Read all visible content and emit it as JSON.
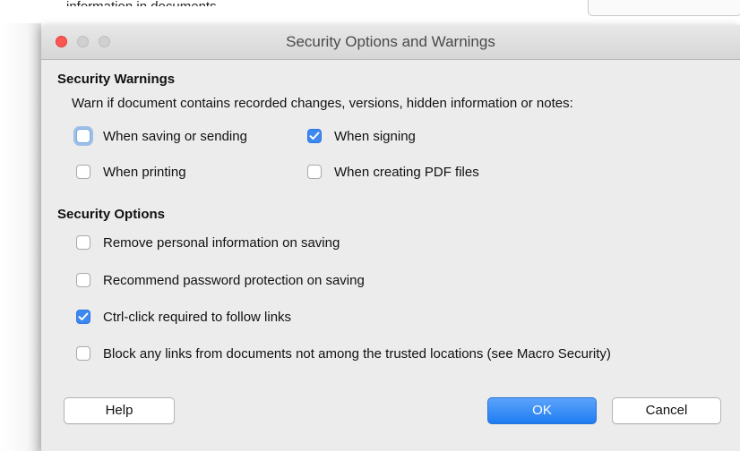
{
  "background": {
    "text": "information in documents."
  },
  "dialog": {
    "title": "Security Options and Warnings",
    "warnings": {
      "heading": "Security Warnings",
      "description": "Warn if document contains recorded changes, versions, hidden information or notes:",
      "options": [
        {
          "label": "When saving or sending",
          "checked": false
        },
        {
          "label": "When signing",
          "checked": true
        },
        {
          "label": "When printing",
          "checked": false
        },
        {
          "label": "When creating PDF files",
          "checked": false
        }
      ]
    },
    "options": {
      "heading": "Security Options",
      "items": [
        {
          "label": "Remove personal information on saving",
          "checked": false
        },
        {
          "label": "Recommend password protection on saving",
          "checked": false
        },
        {
          "label": "Ctrl-click required to follow links",
          "checked": true
        },
        {
          "label": "Block any links from documents not among the trusted locations (see Macro Security)",
          "checked": false
        }
      ]
    },
    "buttons": {
      "help": "Help",
      "ok": "OK",
      "cancel": "Cancel"
    }
  },
  "colors": {
    "accent": "#3d87f0",
    "close_button": "#fc5753",
    "dialog_bg": "#ececec"
  }
}
